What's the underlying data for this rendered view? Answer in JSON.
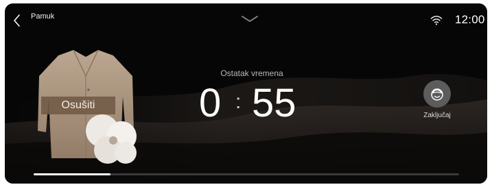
{
  "header": {
    "program_name": "Pamuk",
    "back_icon": "chevron-left-icon",
    "collapse_icon": "chevron-down-icon",
    "wifi_icon": "wifi-icon",
    "clock": "12:00"
  },
  "cycle": {
    "option_label": "Osušiti",
    "time_caption": "Ostatak vremena",
    "hours": "0",
    "separator": ":",
    "minutes": "55",
    "progress": 0.18
  },
  "lock": {
    "label": "Zaključaj",
    "icon": "child-lock-icon"
  },
  "colors": {
    "background": "#060606",
    "label_bg": "#735c48",
    "lock_button_bg": "#5c5c5c",
    "progress_track": "#3a3a3a",
    "progress_fill": "#ffffff"
  }
}
